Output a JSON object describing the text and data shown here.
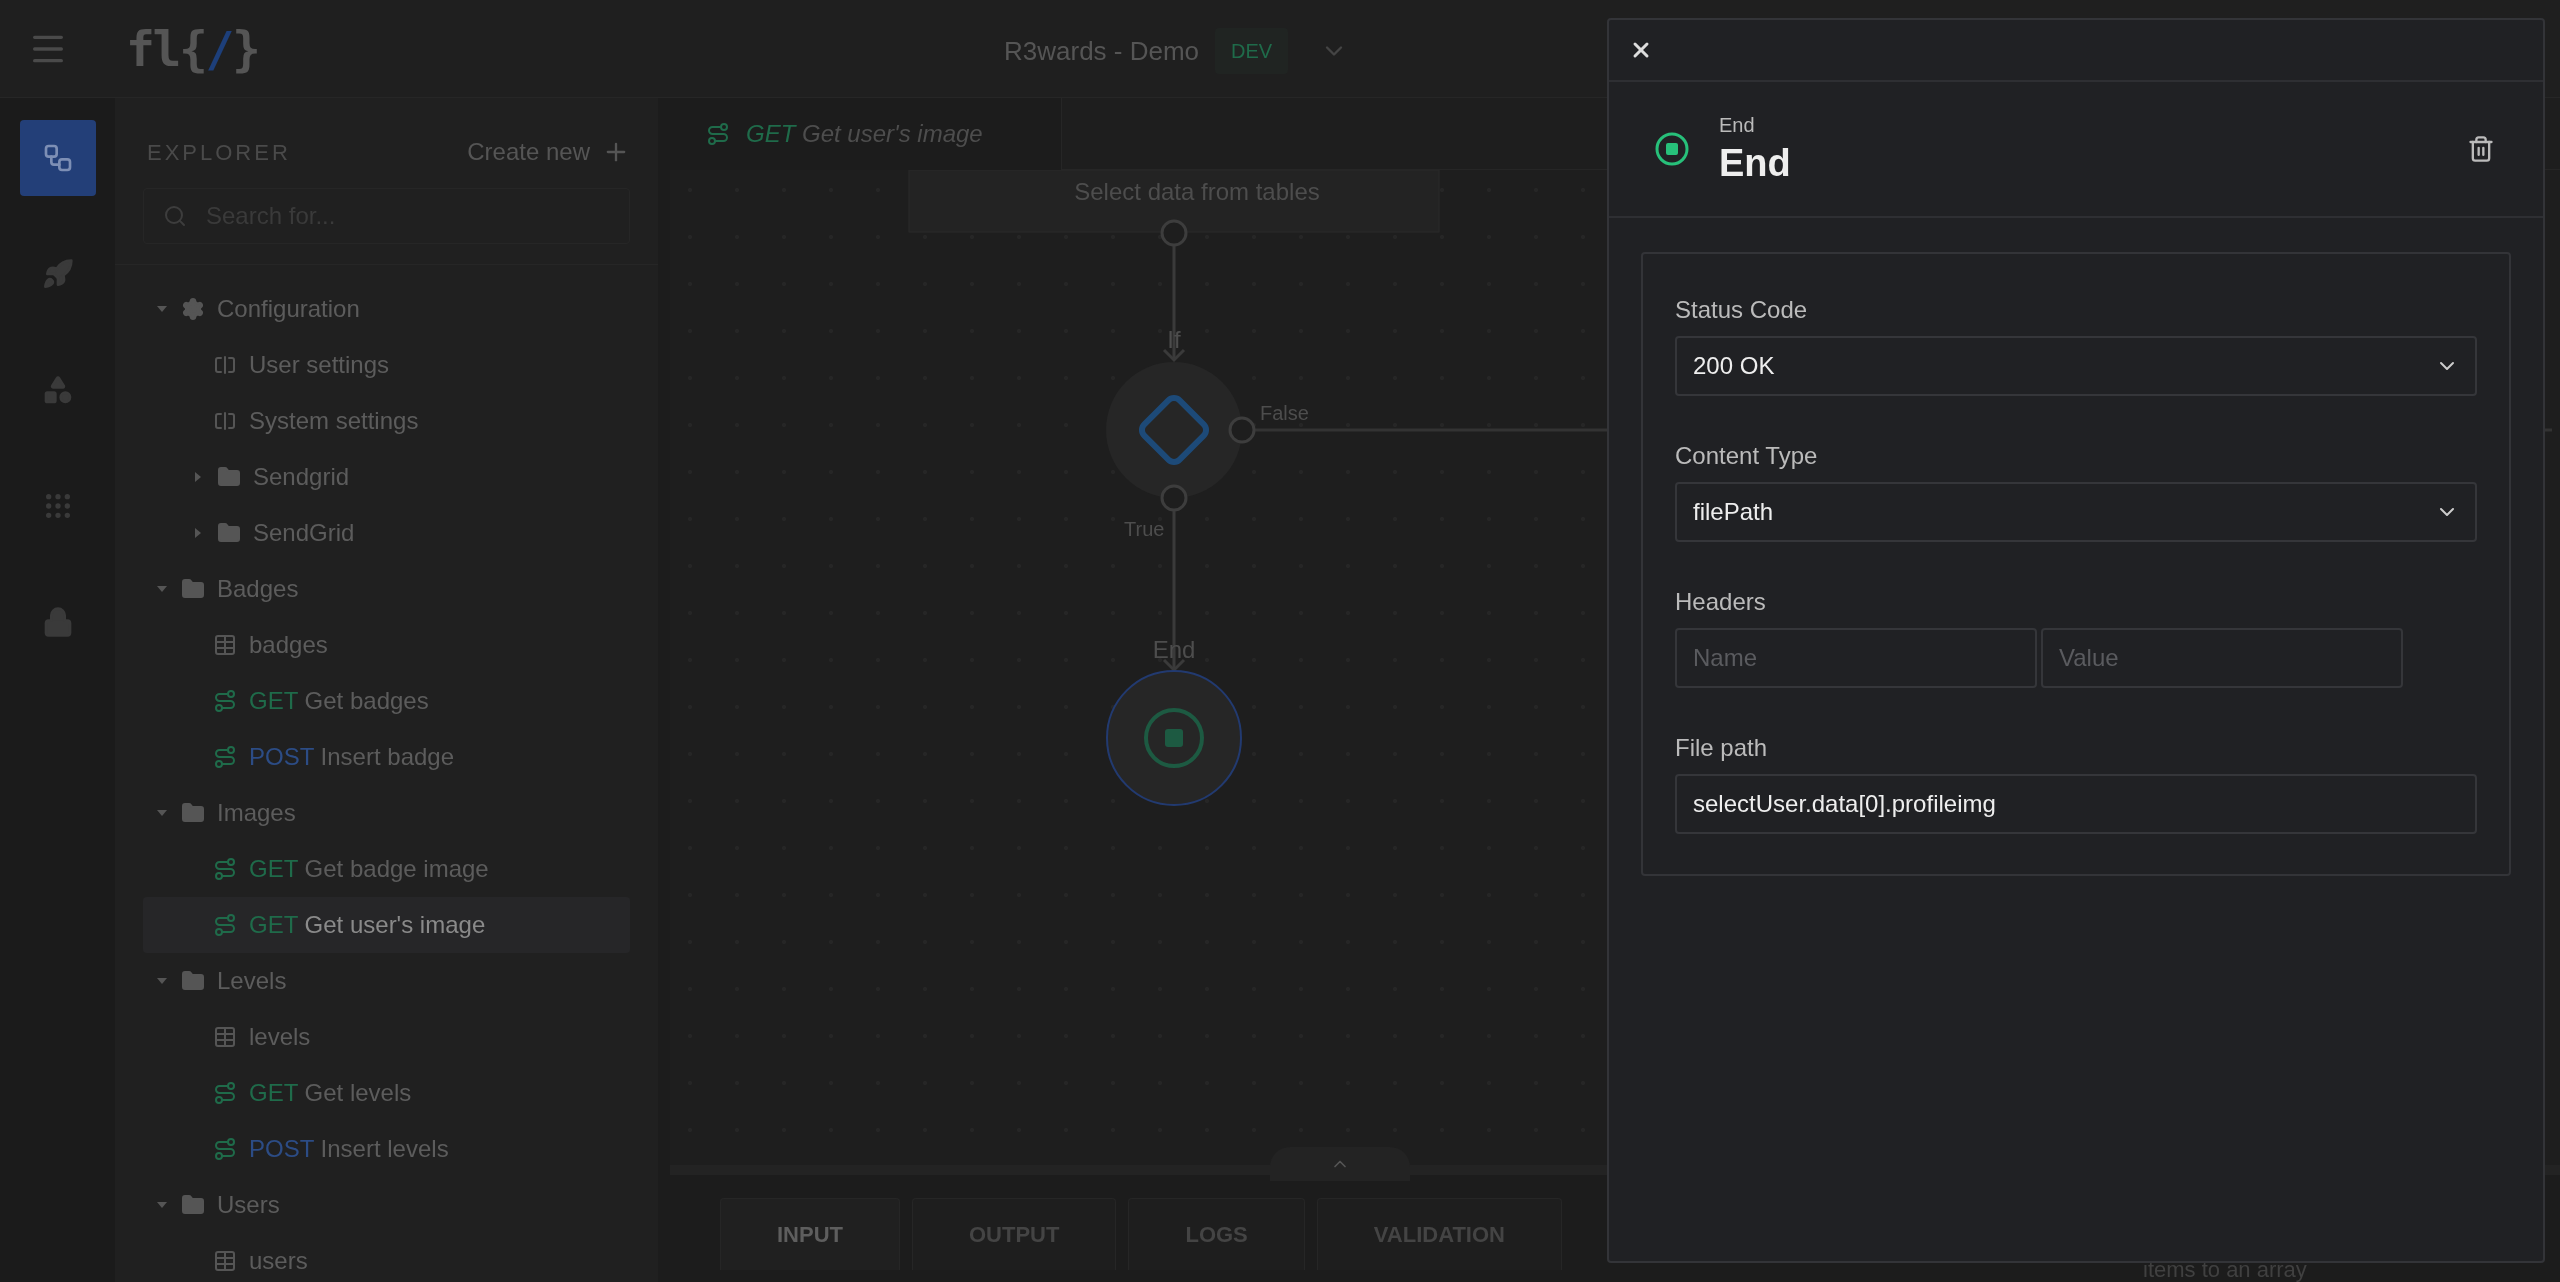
{
  "header": {
    "logo": {
      "start": "fl{",
      "accent": "/",
      "end": "}"
    },
    "project": "R3wards - Demo",
    "env_badge": "DEV"
  },
  "rail": [
    {
      "kind": "flow",
      "selected": true
    },
    {
      "kind": "rocket",
      "selected": false
    },
    {
      "kind": "widgets",
      "selected": false
    },
    {
      "kind": "apps",
      "selected": false
    },
    {
      "kind": "lock",
      "selected": false
    }
  ],
  "explorer": {
    "title": "EXPLORER",
    "create": "Create new",
    "search": {
      "placeholder": "Search for..."
    },
    "tree": [
      {
        "kind": "settings",
        "label": "Configuration",
        "expanded": true,
        "children": [
          {
            "kind": "config",
            "label": "User settings",
            "selected": false
          },
          {
            "kind": "config",
            "label": "System settings",
            "selected": false
          },
          {
            "kind": "folder",
            "label": "Sendgrid",
            "expanded": false
          },
          {
            "kind": "folder",
            "label": "SendGrid",
            "expanded": false
          }
        ]
      },
      {
        "kind": "folder",
        "label": "Badges",
        "expanded": true,
        "children": [
          {
            "kind": "table",
            "label": "badges",
            "selected": false
          },
          {
            "kind": "endpoint",
            "method": {
              "text": "GET",
              "color": "#1f6b4a"
            },
            "label": "Get badges",
            "selected": false
          },
          {
            "kind": "endpoint",
            "method": {
              "text": "POST",
              "color": "#2c4c85"
            },
            "label": "Insert badge",
            "selected": false
          }
        ]
      },
      {
        "kind": "folder",
        "label": "Images",
        "expanded": true,
        "children": [
          {
            "kind": "endpoint",
            "method": {
              "text": "GET",
              "color": "#1f6b4a"
            },
            "label": "Get badge image",
            "selected": false
          },
          {
            "kind": "endpoint",
            "method": {
              "text": "GET",
              "color": "#1f6b4a"
            },
            "label": "Get user's image",
            "selected": true
          }
        ]
      },
      {
        "kind": "folder",
        "label": "Levels",
        "expanded": true,
        "children": [
          {
            "kind": "table",
            "label": "levels",
            "selected": false
          },
          {
            "kind": "endpoint",
            "method": {
              "text": "GET",
              "color": "#1f6b4a"
            },
            "label": "Get levels",
            "selected": false
          },
          {
            "kind": "endpoint",
            "method": {
              "text": "POST",
              "color": "#2c4c85"
            },
            "label": "Insert levels",
            "selected": false
          }
        ]
      },
      {
        "kind": "folder",
        "label": "Users",
        "expanded": true,
        "children": [
          {
            "kind": "table",
            "label": "users",
            "selected": false
          }
        ]
      }
    ]
  },
  "editor_tab": {
    "method": {
      "text": "GET",
      "color": "#1f6b4a"
    },
    "label": "Get user's image"
  },
  "canvas": {
    "select_node": "Select data from tables",
    "if_label": "If",
    "false_label": "False",
    "true_label": "True",
    "end_label": "End",
    "hidden_node_text": "items to an array"
  },
  "bottom_tabs": [
    {
      "label": "INPUT",
      "selected": true
    },
    {
      "label": "OUTPUT",
      "selected": false
    },
    {
      "label": "LOGS",
      "selected": false
    },
    {
      "label": "VALIDATION",
      "selected": false
    }
  ],
  "drawer": {
    "node_type": "End",
    "node_name": "End",
    "fields": [
      {
        "kind": "select",
        "label": "Status Code",
        "value": "200 OK"
      },
      {
        "kind": "select",
        "label": "Content Type",
        "value": "filePath"
      },
      {
        "kind": "pair",
        "label": "Headers",
        "placeholders": [
          "Name",
          "Value"
        ]
      },
      {
        "kind": "text",
        "label": "File path",
        "value": "selectUser.data[0].profileimg"
      }
    ]
  }
}
